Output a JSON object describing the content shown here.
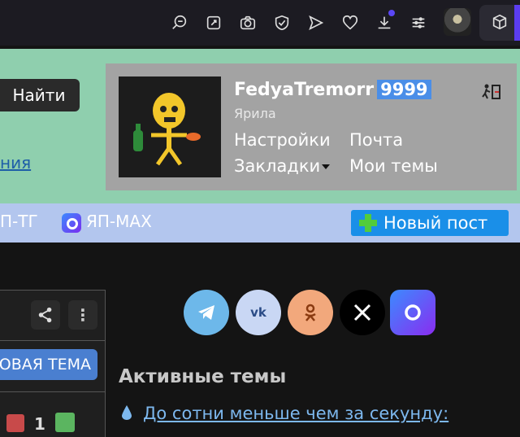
{
  "toolbar": {
    "icons": [
      "zoom-icon",
      "edit-icon",
      "camera-icon",
      "shield-icon",
      "send-icon",
      "heart-icon",
      "download-icon",
      "sliders-icon"
    ]
  },
  "header": {
    "search_button": "Найти",
    "partial_link": "ния"
  },
  "user": {
    "name": "FedyaTremorr",
    "score": "9999",
    "rank": "Ярила",
    "links": {
      "settings": "Настройки",
      "mail": "Почта",
      "bookmarks": "Закладки",
      "my_topics": "Мои темы"
    }
  },
  "nav": {
    "tg": "П-ТГ",
    "max": "ЯП-MAX",
    "new_post": "Новый пост"
  },
  "panel": {
    "new_topic": "ОВАЯ ТЕМА",
    "vote_count": "1"
  },
  "social": [
    "telegram",
    "vk",
    "odnoklassniki",
    "x",
    "max"
  ],
  "active": {
    "title": "Активные темы",
    "first_link": "До сотни меньше чем за секунду:"
  },
  "colors": {
    "header_bg": "#8fcfae",
    "user_box_bg": "#a3a3a3",
    "nav_bg": "#b3c6ee",
    "accent_blue": "#1a8fe8",
    "score_bg": "#4a8ee8"
  }
}
